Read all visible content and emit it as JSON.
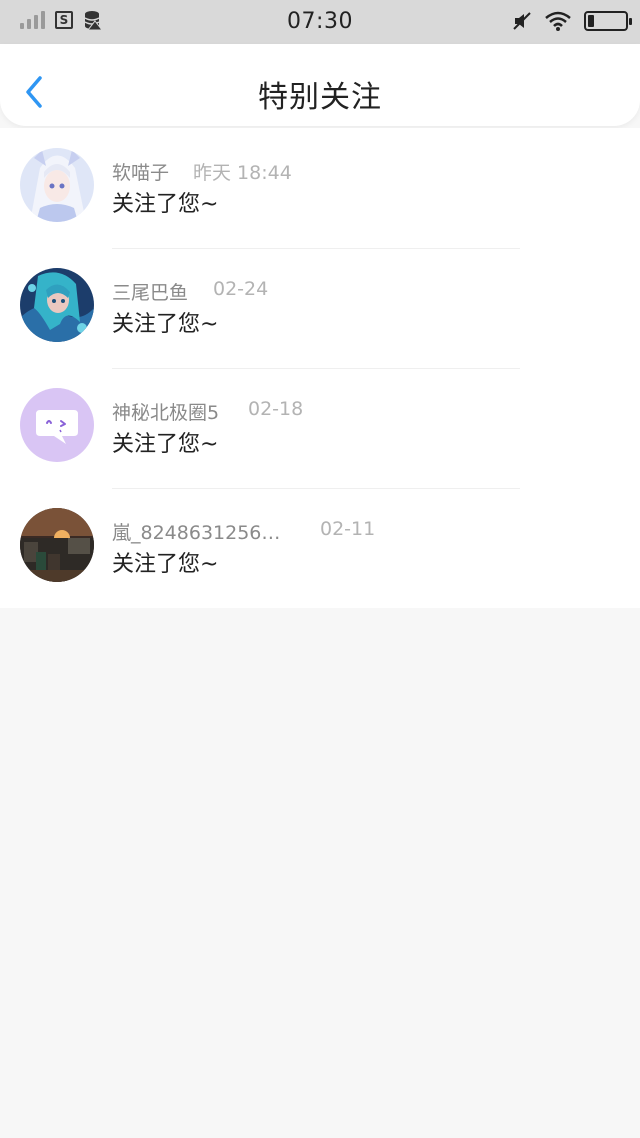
{
  "status_bar": {
    "time": "07:30",
    "box_icon_text": "S"
  },
  "header": {
    "title": "特别关注"
  },
  "items": [
    {
      "name": "软喵子",
      "time": "昨天 18:44",
      "message": "关注了您~",
      "avatar": "anime-girl-white-hair"
    },
    {
      "name": "三尾巴鱼",
      "time": "02-24",
      "message": "关注了您~",
      "avatar": "anime-girl-blue"
    },
    {
      "name": "神秘北极圈5",
      "time": "02-18",
      "message": "关注了您~",
      "avatar": "default-chat-bubble"
    },
    {
      "name": "嵐_8248631256…",
      "time": "02-11",
      "message": "关注了您~",
      "avatar": "minecraft-sunset"
    }
  ],
  "colors": {
    "accent": "#2f96f3",
    "default_avatar_bg": "#d9c5f4",
    "page_bg": "#f7f7f7"
  }
}
